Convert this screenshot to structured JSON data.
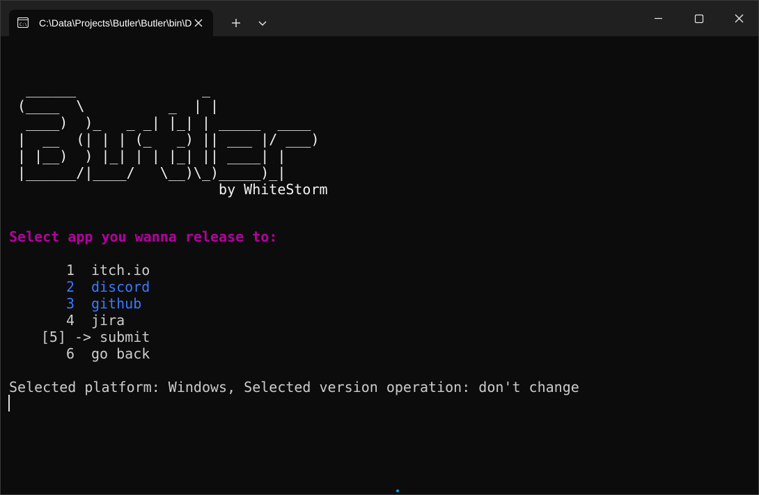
{
  "window": {
    "tab_title": "C:\\Data\\Projects\\Butler\\Butler\\bin\\Debug\\Butler.exe",
    "tab_icon": "terminal-icon",
    "new_tab_icon": "plus-icon",
    "dropdown_icon": "chevron-down-icon",
    "minimize_icon": "minimize-icon",
    "maximize_icon": "maximize-icon",
    "close_icon": "close-icon"
  },
  "terminal": {
    "ascii_art": [
      "  ______               _",
      " (____  \\          _  | |",
      "  ____)  )_   _ _| |_| | _____  ____",
      " |  __  (| | | (_   _) || ___ |/ ___)",
      " | |__)  ) |_| | | |_| || ____| |",
      " |______/|____/   \\__)\\_)_____)_|",
      "                         by WhiteStorm"
    ],
    "prompt": "Select app you wanna release to:",
    "menu": [
      {
        "number": "1",
        "label": "itch.io",
        "state": "normal"
      },
      {
        "number": "2",
        "label": "discord",
        "state": "selected"
      },
      {
        "number": "3",
        "label": "github",
        "state": "selected"
      },
      {
        "number": "4",
        "label": "jira",
        "state": "normal"
      },
      {
        "number": "[5]",
        "label": "-> submit",
        "state": "current"
      },
      {
        "number": "6",
        "label": "go back",
        "state": "normal"
      }
    ],
    "status": "Selected platform: Windows, Selected version operation: don't change"
  },
  "colors": {
    "background": "#0c0c0c",
    "titlebar": "#202020",
    "text": "#cccccc",
    "prompt": "#b4009e",
    "selected": "#3b78ff"
  }
}
